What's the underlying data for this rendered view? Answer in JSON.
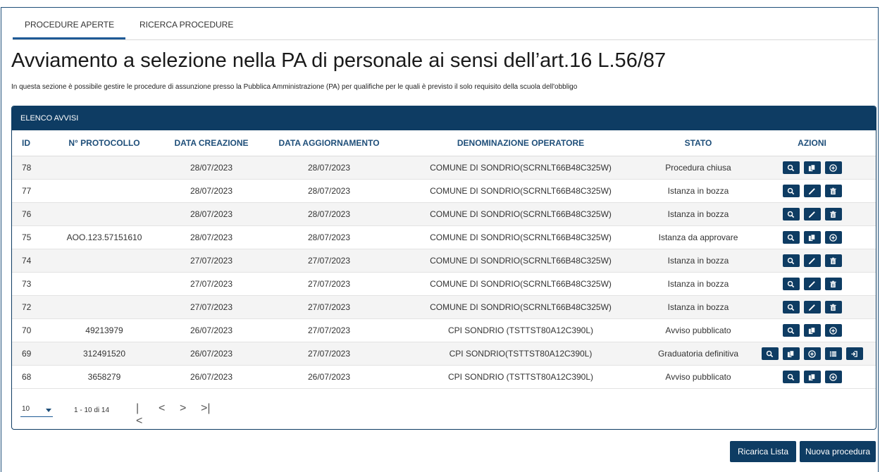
{
  "tabs": [
    {
      "label": "PROCEDURE APERTE"
    },
    {
      "label": "RICERCA PROCEDURE"
    }
  ],
  "title": "Avviamento a selezione nella PA di personale ai sensi dell’art.16 L.56/87",
  "subtitle": "In questa sezione è possibile gestire le procedure di assunzione presso la Pubblica Amministrazione (PA) per qualifiche per le quali è previsto il solo requisito della scuola dell'obbligo",
  "panel": {
    "title": "ELENCO AVVISI",
    "columns": [
      "ID",
      "N° PROTOCOLLO",
      "DATA CREAZIONE",
      "DATA AGGIORNAMENTO",
      "DENOMINAZIONE OPERATORE",
      "STATO",
      "AZIONI"
    ],
    "rows": [
      {
        "id": "78",
        "protocollo": "",
        "creazione": "28/07/2023",
        "aggiornamento": "28/07/2023",
        "operatore": "COMUNE DI SONDRIO(SCRNLT66B48C325W)",
        "stato": "Procedura chiusa",
        "azioni": [
          "search",
          "copy",
          "plus"
        ]
      },
      {
        "id": "77",
        "protocollo": "",
        "creazione": "28/07/2023",
        "aggiornamento": "28/07/2023",
        "operatore": "COMUNE DI SONDRIO(SCRNLT66B48C325W)",
        "stato": "Istanza in bozza",
        "azioni": [
          "search",
          "edit",
          "trash"
        ]
      },
      {
        "id": "76",
        "protocollo": "",
        "creazione": "28/07/2023",
        "aggiornamento": "28/07/2023",
        "operatore": "COMUNE DI SONDRIO(SCRNLT66B48C325W)",
        "stato": "Istanza in bozza",
        "azioni": [
          "search",
          "edit",
          "trash"
        ]
      },
      {
        "id": "75",
        "protocollo": "AOO.123.57151610",
        "creazione": "28/07/2023",
        "aggiornamento": "28/07/2023",
        "operatore": "COMUNE DI SONDRIO(SCRNLT66B48C325W)",
        "stato": "Istanza da approvare",
        "azioni": [
          "search",
          "copy",
          "plus"
        ]
      },
      {
        "id": "74",
        "protocollo": "",
        "creazione": "27/07/2023",
        "aggiornamento": "27/07/2023",
        "operatore": "COMUNE DI SONDRIO(SCRNLT66B48C325W)",
        "stato": "Istanza in bozza",
        "azioni": [
          "search",
          "edit",
          "trash"
        ]
      },
      {
        "id": "73",
        "protocollo": "",
        "creazione": "27/07/2023",
        "aggiornamento": "27/07/2023",
        "operatore": "COMUNE DI SONDRIO(SCRNLT66B48C325W)",
        "stato": "Istanza in bozza",
        "azioni": [
          "search",
          "edit",
          "trash"
        ]
      },
      {
        "id": "72",
        "protocollo": "",
        "creazione": "27/07/2023",
        "aggiornamento": "27/07/2023",
        "operatore": "COMUNE DI SONDRIO(SCRNLT66B48C325W)",
        "stato": "Istanza in bozza",
        "azioni": [
          "search",
          "edit",
          "trash"
        ]
      },
      {
        "id": "70",
        "protocollo": "49213979",
        "creazione": "26/07/2023",
        "aggiornamento": "27/07/2023",
        "operatore": "CPI SONDRIO (TSTTST80A12C390L)",
        "stato": "Avviso pubblicato",
        "azioni": [
          "search",
          "copy",
          "plus"
        ]
      },
      {
        "id": "69",
        "protocollo": "312491520",
        "creazione": "26/07/2023",
        "aggiornamento": "27/07/2023",
        "operatore": "CPI SONDRIO(TSTTST80A12C390L)",
        "stato": "Graduatoria definitiva",
        "azioni": [
          "search",
          "copy",
          "plus",
          "list",
          "login"
        ]
      },
      {
        "id": "68",
        "protocollo": "3658279",
        "creazione": "26/07/2023",
        "aggiornamento": "26/07/2023",
        "operatore": "CPI SONDRIO (TSTTST80A12C390L)",
        "stato": "Avviso pubblicato",
        "azioni": [
          "search",
          "copy",
          "plus"
        ]
      }
    ]
  },
  "pagination": {
    "page_size": "10",
    "range_label": "1 - 10 di 14",
    "first": "|<",
    "prev": "<",
    "next": ">",
    "last": ">|"
  },
  "buttons": {
    "reload": "Ricarica Lista",
    "new": "Nuova procedura"
  },
  "colors": {
    "primary": "#0e3c63",
    "header_text": "#1e4e79"
  }
}
